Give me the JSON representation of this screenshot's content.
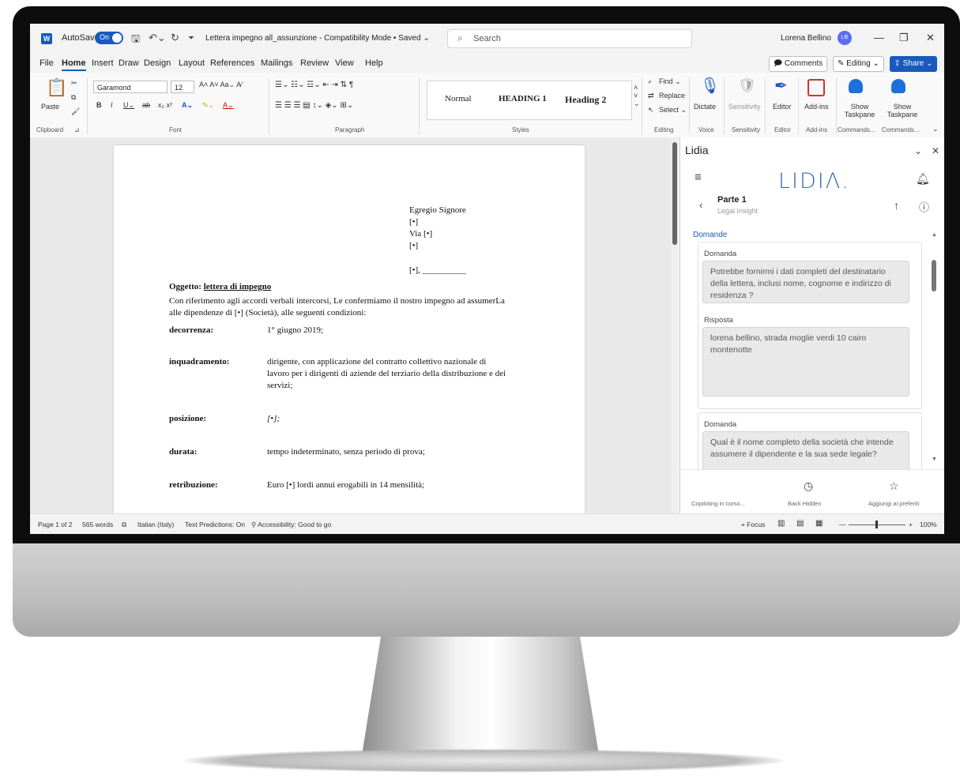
{
  "titlebar": {
    "autosave_label": "AutoSave",
    "autosave_state": "On",
    "doc_title": "Lettera impegno all_assunzione  -  Compatibility Mode • Saved ⌄",
    "search_placeholder": "Search",
    "user_name": "Lorena Bellino",
    "user_initials": "LB"
  },
  "menu": {
    "items": [
      "File",
      "Home",
      "Insert",
      "Draw",
      "Design",
      "Layout",
      "References",
      "Mailings",
      "Review",
      "View",
      "Help"
    ],
    "comments": "Comments",
    "editing": "Editing ⌄",
    "share": "Share ⌄"
  },
  "ribbon": {
    "paste": "Paste",
    "font_name": "Garamond",
    "font_size": "12",
    "styles": [
      "Normal",
      "HEADING 1",
      "Heading 2"
    ],
    "find": "Find ⌄",
    "replace": "Replace",
    "select": "Select ⌄",
    "dictate": "Dictate",
    "sensitivity": "Sensitivity",
    "editor": "Editor",
    "addins": "Add-ins",
    "show_taskpane_1": "Show Taskpane",
    "show_taskpane_2": "Show Taskpane",
    "group_labels": [
      "Clipboard",
      "Font",
      "Paragraph",
      "Styles",
      "Editing",
      "Voice",
      "Sensitivity",
      "Editor",
      "Add-ins",
      "Commands...",
      "Commands..."
    ]
  },
  "document": {
    "addr1": "Egregio Signore",
    "addr2": "[•]",
    "addr3": "Via [•]",
    "addr4": "[•]",
    "date_line": "[•], __________",
    "subject_prefix": "Oggetto: ",
    "subject": "lettera di impegno",
    "intro1": "Con riferimento agli accordi verbali intercorsi, Le confermiamo il nostro impegno ad assumerLa",
    "intro2": "alle dipendenze di [•] (Società), alle seguenti condizioni:",
    "decorrenza_label": "decorrenza:",
    "decorrenza_value": "1° giugno 2019;",
    "inquadramento_label": "inquadramento:",
    "inquadramento_1": "dirigente, con applicazione del contratto collettivo nazionale di",
    "inquadramento_2": "lavoro per i dirigenti di aziende del terziario della distribuzione e dei",
    "inquadramento_3": "servizi;",
    "posizione_label": "posizione:",
    "posizione_value": "[•];",
    "durata_label": "durata:",
    "durata_value": "tempo indeterminato, senza periodo di prova;",
    "retribuzione_label": "retribuzione:",
    "retribuzione_value": "Euro [•] lordi annui erogabili in 14 mensilità;"
  },
  "pane": {
    "title": "Lidia",
    "logo": "LIDIΛ.",
    "section_title": "Parte 1",
    "section_sub": "Legal Insight",
    "domande": "Domande",
    "q_label": "Domanda",
    "a_label": "Risposta",
    "q1": "Potrebbe fornirmi i dati completi del destinatario della lettera, inclusi nome, cognome e indirizzo di residenza ?",
    "a1": "lorena bellino, strada moglie verdi 10 cairo montenotte",
    "q2": "Qual è il nome completo della società che intende assumere il dipendente e la sua sede legale?",
    "footer_left": "Copiloting in corso...",
    "footer_mid": "Back Hidden",
    "footer_right": "Aggiungi ai preferiti"
  },
  "status": {
    "page": "Page 1 of 2",
    "words": "565 words",
    "language": "Italian (Italy)",
    "predictions": "Text Predictions: On",
    "accessibility": "Accessibility: Good to go",
    "focus": "Focus",
    "zoom": "100%"
  }
}
